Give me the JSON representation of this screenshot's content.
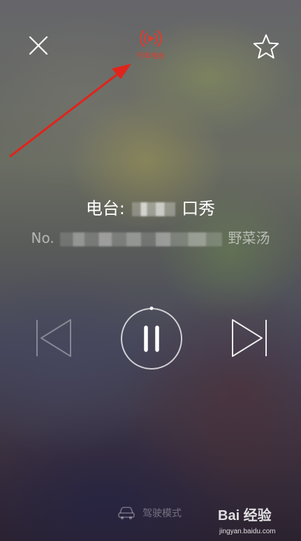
{
  "header": {
    "close_icon": "close-icon",
    "drive_radio_label": "行车电台",
    "drive_radio_icon": "radio-play-icon",
    "favorite_icon": "star-icon",
    "accent_color": "#e23a2e"
  },
  "now_playing": {
    "station_prefix": "电台:",
    "station_suffix": "口秀",
    "track_prefix": "No.",
    "track_suffix": "野菜汤"
  },
  "controls": {
    "prev_icon": "previous-icon",
    "pause_icon": "pause-icon",
    "next_icon": "next-icon"
  },
  "footer": {
    "drive_mode_label": "驾驶模式",
    "drive_mode_icon": "car-icon"
  },
  "watermark": {
    "brand": "Bai 经验",
    "url": "jingyan.baidu.com"
  }
}
